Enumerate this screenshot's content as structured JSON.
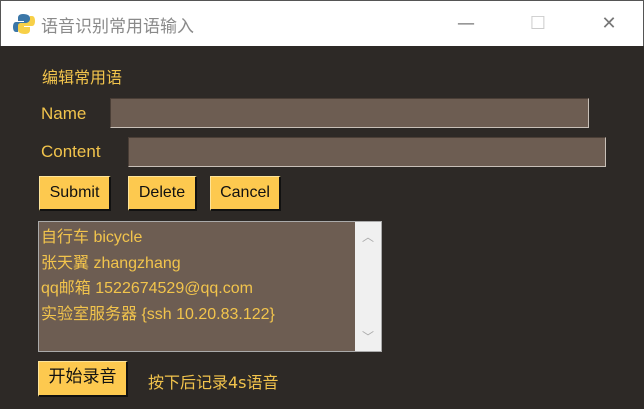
{
  "window": {
    "title": "语音识别常用语输入",
    "minimize": "—",
    "maximize": "☐",
    "close": "✕"
  },
  "form": {
    "heading": "编辑常用语",
    "name_label": "Name",
    "name_value": "",
    "content_label": "Content",
    "content_value": ""
  },
  "buttons": {
    "submit": "Submit",
    "delete": "Delete",
    "cancel": "Cancel",
    "record": "开始录音"
  },
  "list": {
    "items": [
      "自行车 bicycle",
      "张天翼 zhangzhang",
      "qq邮箱 1522674529@qq.com",
      "实验室服务器 {ssh 10.20.83.122}"
    ],
    "scroll_up": "︿",
    "scroll_down": "﹀"
  },
  "hint": "按下后记录4s语音",
  "colors": {
    "background": "#2d2926",
    "text": "#f2c44c",
    "button": "#fdc94f",
    "entry": "#6d5d52"
  }
}
